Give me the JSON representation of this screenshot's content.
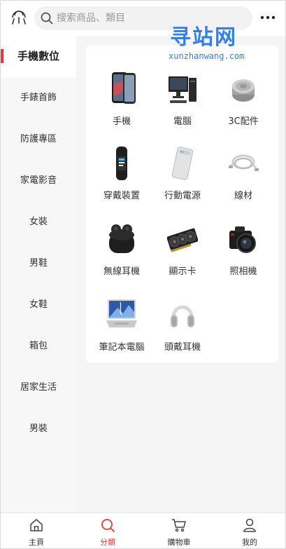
{
  "header": {
    "search_placeholder": "搜索商品、類目",
    "logo_icon": "chat-bubbles-icon",
    "more_icon": "more-dots-icon"
  },
  "watermark": {
    "title": "寻站网",
    "url": "xunzhanwang.com"
  },
  "sidebar": {
    "items": [
      {
        "label": "手機數位"
      },
      {
        "label": "手錶首飾"
      },
      {
        "label": "防護專區"
      },
      {
        "label": "家電影音"
      },
      {
        "label": "女裝"
      },
      {
        "label": "男鞋"
      },
      {
        "label": "女鞋"
      },
      {
        "label": "箱包"
      },
      {
        "label": "居家生活"
      },
      {
        "label": "男裝"
      }
    ],
    "active_index": 0
  },
  "categories": {
    "items": [
      {
        "label": "手機",
        "icon": "smartphone-icon"
      },
      {
        "label": "電腦",
        "icon": "desktop-computer-icon"
      },
      {
        "label": "3C配件",
        "icon": "speaker-icon"
      },
      {
        "label": "穿戴裝置",
        "icon": "smart-band-icon"
      },
      {
        "label": "行動電源",
        "icon": "power-bank-icon"
      },
      {
        "label": "線材",
        "icon": "cable-icon"
      },
      {
        "label": "無線耳機",
        "icon": "wireless-earbuds-icon"
      },
      {
        "label": "顯示卡",
        "icon": "graphics-card-icon"
      },
      {
        "label": "照相機",
        "icon": "camera-icon"
      },
      {
        "label": "筆記本電腦",
        "icon": "laptop-icon"
      },
      {
        "label": "頭戴耳機",
        "icon": "headphones-icon"
      }
    ]
  },
  "tabbar": {
    "tabs": [
      {
        "label": "主頁",
        "icon": "home-icon"
      },
      {
        "label": "分類",
        "icon": "search-tab-icon"
      },
      {
        "label": "購物車",
        "icon": "cart-icon"
      },
      {
        "label": "我的",
        "icon": "user-icon"
      }
    ],
    "active_index": 1
  },
  "colors": {
    "accent": "#e53935",
    "watermark": "#2f7ff3",
    "sidebar_bg": "#f7f7f7",
    "content_bg": "#f5f5f5"
  }
}
